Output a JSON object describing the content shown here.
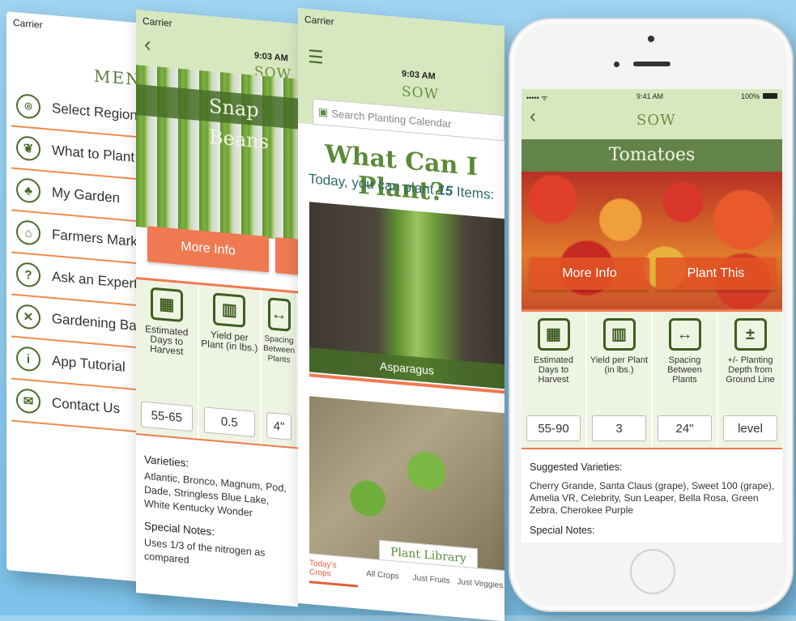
{
  "menu_screen": {
    "carrier": "Carrier",
    "title": "MENU",
    "items": [
      {
        "label": "Select Region",
        "icon": "location-pin-icon"
      },
      {
        "label": "What to Plant",
        "icon": "seedling-icon"
      },
      {
        "label": "My Garden",
        "icon": "garden-icon"
      },
      {
        "label": "Farmers Market",
        "icon": "market-stall-icon"
      },
      {
        "label": "Ask an Expert",
        "icon": "expert-icon"
      },
      {
        "label": "Gardening Basics",
        "icon": "tools-icon"
      },
      {
        "label": "App Tutorial",
        "icon": "info-icon"
      },
      {
        "label": "Contact Us",
        "icon": "envelope-icon"
      }
    ]
  },
  "beans_screen": {
    "carrier": "Carrier",
    "time": "9:03 AM",
    "app_title": "SOW",
    "crop_name": "Snap Beans",
    "more_info": "More Info",
    "stats": [
      {
        "label": "Estimated Days to Harvest",
        "value": "55-65",
        "icon": "calendar-icon"
      },
      {
        "label": "Yield per Plant (in lbs.)",
        "value": "0.5",
        "icon": "basket-icon"
      },
      {
        "label": "Spacing Between Plants",
        "value": "4\"",
        "icon": "spacing-icon"
      }
    ],
    "varieties_heading": "Varieties:",
    "varieties_text": "Atlantic, Bronco, Magnum, Pod, Dade, Stringless Blue Lake, White Kentucky Wonder",
    "notes_heading": "Special Notes:",
    "notes_text": "Uses 1/3 of the nitrogen as compared"
  },
  "calendar_screen": {
    "carrier": "Carrier",
    "time": "9:03 AM",
    "app_title": "SOW",
    "search_placeholder": "Search Planting Calendar",
    "headline": "What Can I Plant?",
    "today_prefix": "Today, you can plant ",
    "today_count": "15",
    "today_suffix": " Items:",
    "first_crop": "Asparagus",
    "library_tab": "Plant Library",
    "tabs": [
      {
        "label": "Today's Crops",
        "active": true
      },
      {
        "label": "All Crops",
        "active": false
      },
      {
        "label": "Just Fruits",
        "active": false
      },
      {
        "label": "Just Veggies",
        "active": false
      }
    ]
  },
  "phone_screen": {
    "signal": "••••• ᯤ",
    "time": "9:41 AM",
    "battery": "100%",
    "app_title": "SOW",
    "crop_name": "Tomatoes",
    "more_info": "More Info",
    "plant_this": "Plant This",
    "stats": [
      {
        "label": "Estimated Days to Harvest",
        "value": "55-90",
        "icon": "calendar-icon"
      },
      {
        "label": "Yield per Plant (in lbs.)",
        "value": "3",
        "icon": "basket-icon"
      },
      {
        "label": "Spacing Between Plants",
        "value": "24\"",
        "icon": "spacing-icon"
      },
      {
        "label": "+/- Planting Depth from Ground Line",
        "value": "level",
        "icon": "depth-icon"
      }
    ],
    "varieties_heading": "Suggested Varieties:",
    "varieties_text": "Cherry Grande, Santa Claus (grape), Sweet 100 (grape), Amelia VR, Celebrity, Sun Leaper, Bella Rosa, Green Zebra, Cherokee Purple",
    "notes_heading": "Special Notes:"
  },
  "colors": {
    "accent_orange": "#ef7a52",
    "brand_green": "#5b8a3a",
    "header_green": "#d7e8bf",
    "background_blue": "#8ccbee"
  }
}
